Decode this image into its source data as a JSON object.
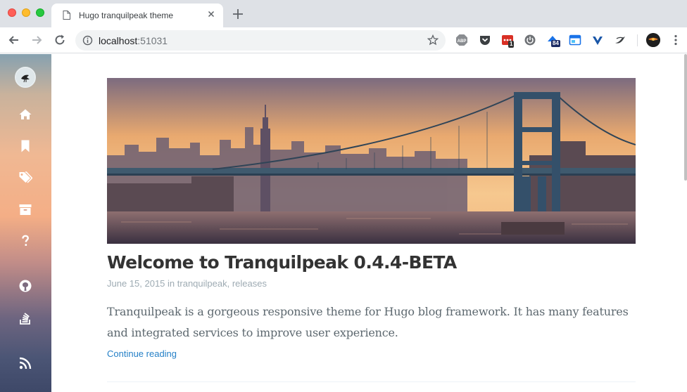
{
  "browser": {
    "tab": {
      "title": "Hugo tranquilpeak theme",
      "icon": "page-icon",
      "close_icon": "close-icon"
    },
    "new_tab_icon": "plus-icon",
    "toolbar": {
      "back_icon": "arrow-left-icon",
      "forward_icon": "arrow-right-icon",
      "reload_icon": "reload-icon",
      "url_host": "localhost",
      "url_port": ":51031",
      "bookmark_icon": "star-icon"
    },
    "extensions": [
      {
        "name": "adblock-plus-icon",
        "label": "ABP"
      },
      {
        "name": "pocket-icon"
      },
      {
        "name": "calendar-ext-icon",
        "badge": "1"
      },
      {
        "name": "power-icon"
      },
      {
        "name": "ext-cloud-icon",
        "badge": "84"
      },
      {
        "name": "window-ext-icon"
      },
      {
        "name": "vimeo-like-icon"
      },
      {
        "name": "bird-ext-icon"
      }
    ],
    "colors": {
      "tabbar": "#dee1e6",
      "accent_red": "#ff5f57"
    }
  },
  "sidebar": {
    "items": [
      {
        "name": "home-icon"
      },
      {
        "name": "bookmark-icon"
      },
      {
        "name": "tags-icon"
      },
      {
        "name": "archive-icon"
      },
      {
        "name": "question-icon"
      },
      {
        "name": "github-icon"
      },
      {
        "name": "stack-overflow-icon"
      },
      {
        "name": "rss-icon"
      }
    ]
  },
  "post": {
    "title": "Welcome to Tranquilpeak 0.4.4-BETA",
    "date": "June 15, 2015",
    "in_word": "in",
    "categories": [
      "tranquilpeak",
      "releases"
    ],
    "excerpt": "Tranquilpeak is a gorgeous responsive theme for Hugo blog framework. It has many features and integrated services to improve user experience.",
    "continue_label": "Continue reading",
    "link_color": "#2580c7"
  }
}
